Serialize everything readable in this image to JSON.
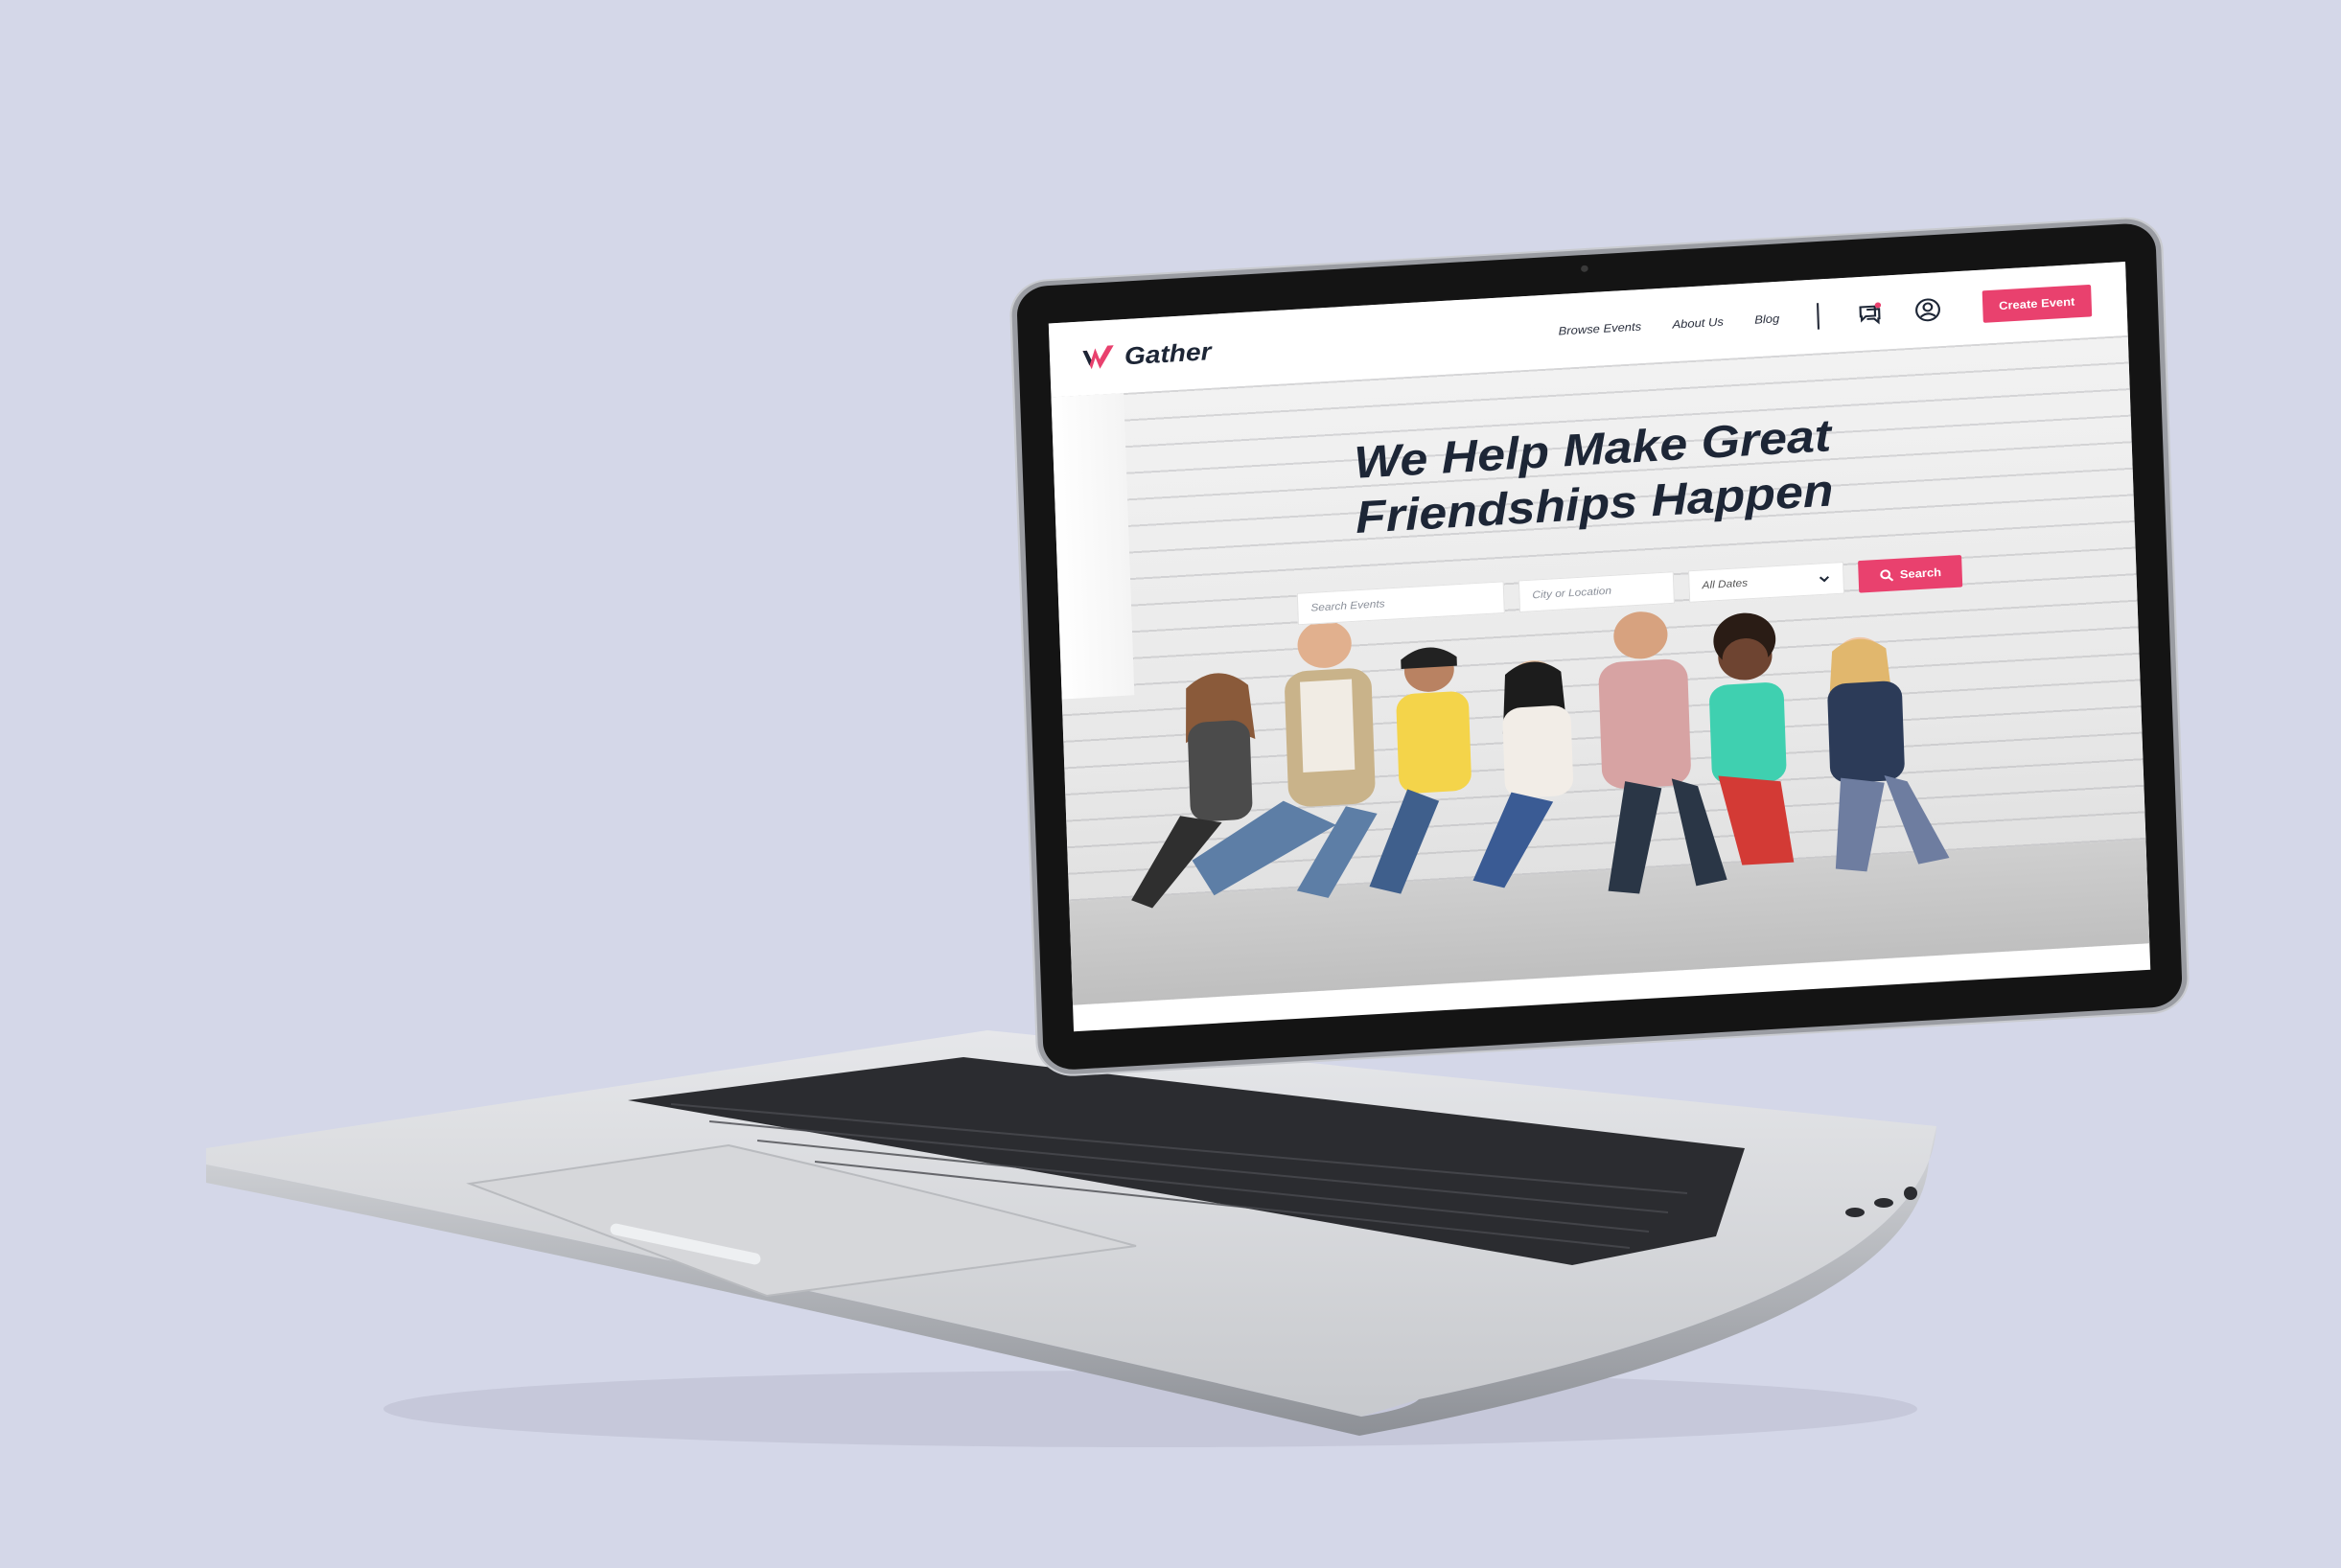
{
  "brand": {
    "name": "Gather",
    "accent_color": "#e9416e",
    "text_color": "#1d2636",
    "logo_icon": "gather-logo-icon"
  },
  "nav": {
    "links": [
      "Browse Events",
      "About Us",
      "Blog"
    ],
    "chat_icon": "chat-bubbles-icon",
    "account_icon": "user-circle-icon",
    "create_button": "Create Event"
  },
  "hero": {
    "headline_line1": "We Help Make Great",
    "headline_line2": "Friendships Happen",
    "search_placeholder": "Search Events",
    "location_placeholder": "City or Location",
    "dates_value": "All Dates",
    "dates_icon": "chevron-down-icon",
    "search_button": "Search",
    "search_icon": "search-icon"
  }
}
